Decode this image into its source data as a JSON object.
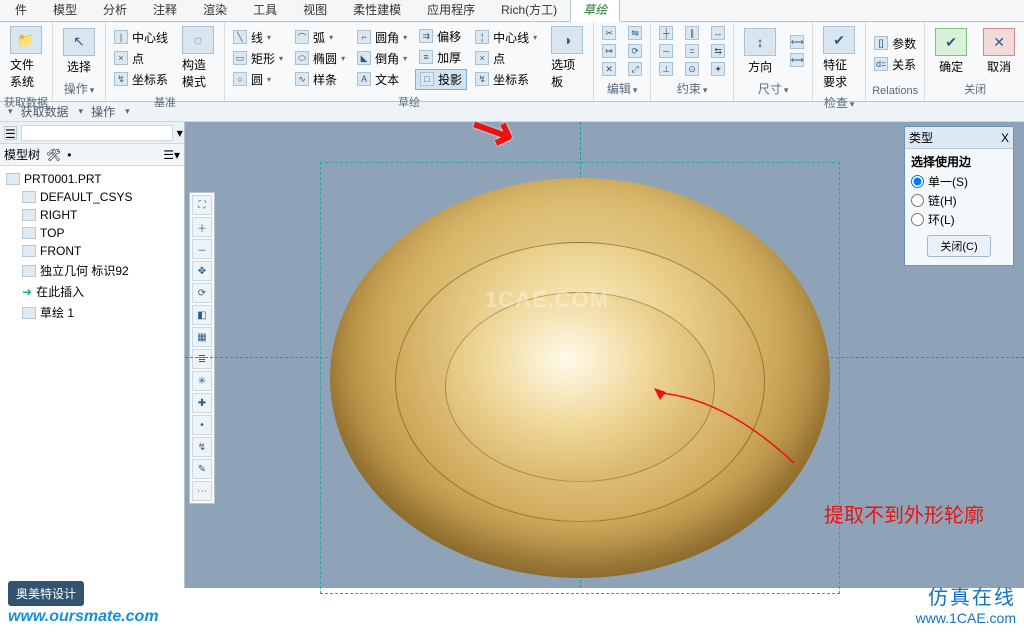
{
  "tabs": [
    "件",
    "模型",
    "分析",
    "注释",
    "渲染",
    "工具",
    "视图",
    "柔性建模",
    "应用程序",
    "Rich(方工)",
    "草绘"
  ],
  "active_tab": 10,
  "ribbon": {
    "file": {
      "label": "文件\n系统",
      "menu": "▾"
    },
    "select": {
      "label": "选择",
      "menu": "▾"
    },
    "g_getdata": "获取数据",
    "g_ops": "操作",
    "g_datum": "基准",
    "g_sketch": "草绘",
    "g_edit": "编辑",
    "g_constrain": "约束",
    "g_dim": "尺寸",
    "g_check": "检查",
    "g_rel": "Relations",
    "g_close": "关闭",
    "center": "中心线",
    "point": "点",
    "csys": "坐标系",
    "construct": "构造\n模式",
    "line": "线",
    "rect": "矩形",
    "circle": "圆",
    "arc": "弧",
    "ellipse": "椭圆",
    "spline": "样条",
    "fillet": "圆角",
    "chamfer": "倒角",
    "text": "文本",
    "offset": "偏移",
    "thicken": "加厚",
    "project": "投影",
    "centerline2": "中心线",
    "point2": "点",
    "csys2": "坐标系",
    "palette": "选项\n板",
    "direction": "方向",
    "featreq": "特征\n要求",
    "params": "参数",
    "relation": "关系",
    "ok": "确定",
    "cancel": "取消"
  },
  "subbar": {
    "getdata": "获取数据",
    "ops": "操作",
    "caret": "▾"
  },
  "tree_title": "模型树",
  "tree": {
    "root": "PRT0001.PRT",
    "items": [
      "DEFAULT_CSYS",
      "RIGHT",
      "TOP",
      "FRONT",
      "独立几何 标识92",
      "在此插入",
      "草绘 1"
    ]
  },
  "panel": {
    "title": "类型",
    "close": "X",
    "heading": "选择使用边",
    "opts": [
      "单一(S)",
      "链(H)",
      "环(L)"
    ],
    "close_btn": "关闭(C)"
  },
  "watermark": "1CAE.COM",
  "note": "提取不到外形轮廓",
  "footer": {
    "brand": "奥美特设计",
    "url1": "www.oursmate.com",
    "cn": "仿真在线",
    "url2": "www.1CAE.com"
  }
}
